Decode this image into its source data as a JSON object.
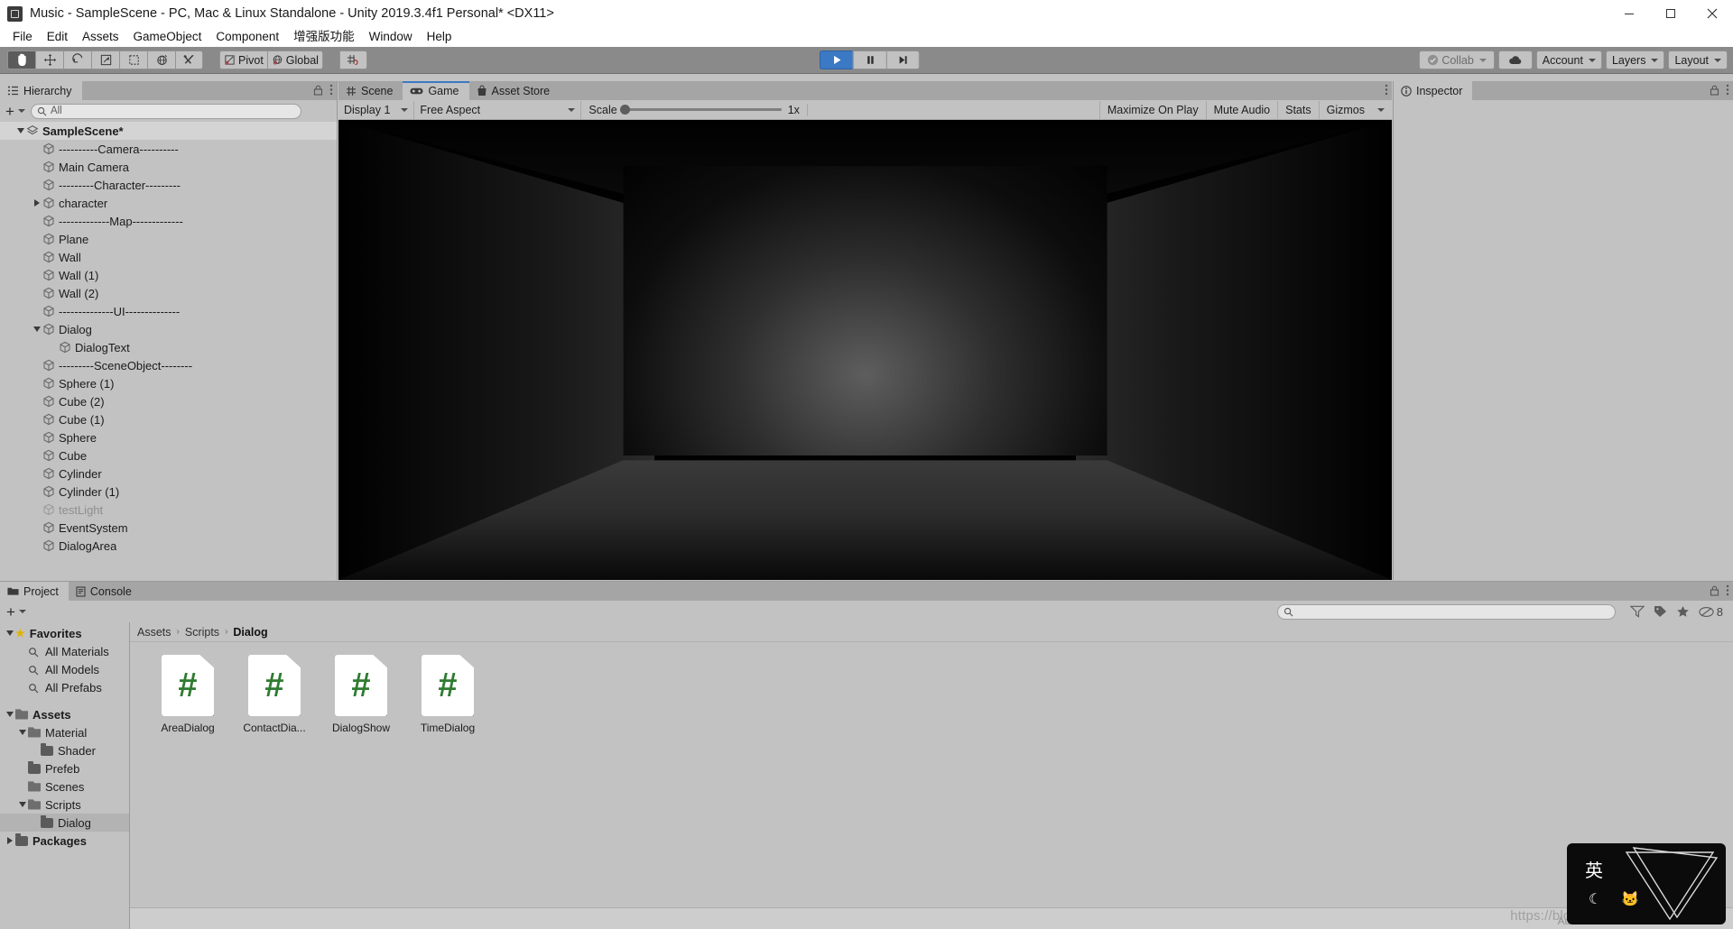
{
  "window": {
    "title": "Music - SampleScene - PC, Mac & Linux Standalone - Unity 2019.3.4f1 Personal* <DX11>",
    "app_icon": "unity-icon",
    "minimize": "minimize-icon",
    "maximize": "maximize-icon",
    "close": "close-icon"
  },
  "menu": {
    "items": [
      "File",
      "Edit",
      "Assets",
      "GameObject",
      "Component",
      "增强版功能",
      "Window",
      "Help"
    ]
  },
  "toolbar": {
    "tools": [
      {
        "name": "hand-tool",
        "selected": true
      },
      {
        "name": "move-tool",
        "selected": false
      },
      {
        "name": "rotate-tool",
        "selected": false
      },
      {
        "name": "scale-tool",
        "selected": false
      },
      {
        "name": "rect-tool",
        "selected": false
      },
      {
        "name": "transform-tool",
        "selected": false
      },
      {
        "name": "custom-tool",
        "selected": false
      }
    ],
    "pivot_label": "Pivot",
    "global_label": "Global",
    "grid_label": "grid-snap",
    "play_label": "play",
    "pause_label": "pause",
    "step_label": "step",
    "play_active": true,
    "collab_label": "Collab",
    "cloud_label": "cloud-icon",
    "account_label": "Account",
    "layers_label": "Layers",
    "layout_label": "Layout",
    "accent_blue": "#3b79c4"
  },
  "hierarchy": {
    "tab_label": "Hierarchy",
    "search_placeholder": "All",
    "add_label": "+",
    "items": [
      {
        "label": "SampleScene*",
        "indent": 0,
        "arrow": "down",
        "icon": "scene-icon",
        "selected": true,
        "bold": true,
        "disabled": false
      },
      {
        "label": "----------Camera----------",
        "indent": 1,
        "arrow": "none",
        "icon": "gameobject-icon",
        "selected": false,
        "bold": false,
        "disabled": false
      },
      {
        "label": "Main Camera",
        "indent": 1,
        "arrow": "none",
        "icon": "gameobject-icon",
        "selected": false,
        "bold": false,
        "disabled": false
      },
      {
        "label": "---------Character---------",
        "indent": 1,
        "arrow": "none",
        "icon": "gameobject-icon",
        "selected": false,
        "bold": false,
        "disabled": false
      },
      {
        "label": "character",
        "indent": 1,
        "arrow": "right",
        "icon": "gameobject-icon",
        "selected": false,
        "bold": false,
        "disabled": false
      },
      {
        "label": "-------------Map-------------",
        "indent": 1,
        "arrow": "none",
        "icon": "gameobject-icon",
        "selected": false,
        "bold": false,
        "disabled": false
      },
      {
        "label": "Plane",
        "indent": 1,
        "arrow": "none",
        "icon": "gameobject-icon",
        "selected": false,
        "bold": false,
        "disabled": false
      },
      {
        "label": "Wall",
        "indent": 1,
        "arrow": "none",
        "icon": "gameobject-icon",
        "selected": false,
        "bold": false,
        "disabled": false
      },
      {
        "label": "Wall (1)",
        "indent": 1,
        "arrow": "none",
        "icon": "gameobject-icon",
        "selected": false,
        "bold": false,
        "disabled": false
      },
      {
        "label": "Wall (2)",
        "indent": 1,
        "arrow": "none",
        "icon": "gameobject-icon",
        "selected": false,
        "bold": false,
        "disabled": false
      },
      {
        "label": "--------------UI--------------",
        "indent": 1,
        "arrow": "none",
        "icon": "gameobject-icon",
        "selected": false,
        "bold": false,
        "disabled": false
      },
      {
        "label": "Dialog",
        "indent": 1,
        "arrow": "down",
        "icon": "gameobject-icon",
        "selected": false,
        "bold": false,
        "disabled": false
      },
      {
        "label": "DialogText",
        "indent": 2,
        "arrow": "none",
        "icon": "gameobject-icon",
        "selected": false,
        "bold": false,
        "disabled": false
      },
      {
        "label": "---------SceneObject--------",
        "indent": 1,
        "arrow": "none",
        "icon": "gameobject-icon",
        "selected": false,
        "bold": false,
        "disabled": false
      },
      {
        "label": "Sphere (1)",
        "indent": 1,
        "arrow": "none",
        "icon": "gameobject-icon",
        "selected": false,
        "bold": false,
        "disabled": false
      },
      {
        "label": "Cube (2)",
        "indent": 1,
        "arrow": "none",
        "icon": "gameobject-icon",
        "selected": false,
        "bold": false,
        "disabled": false
      },
      {
        "label": "Cube (1)",
        "indent": 1,
        "arrow": "none",
        "icon": "gameobject-icon",
        "selected": false,
        "bold": false,
        "disabled": false
      },
      {
        "label": "Sphere",
        "indent": 1,
        "arrow": "none",
        "icon": "gameobject-icon",
        "selected": false,
        "bold": false,
        "disabled": false
      },
      {
        "label": "Cube",
        "indent": 1,
        "arrow": "none",
        "icon": "gameobject-icon",
        "selected": false,
        "bold": false,
        "disabled": false
      },
      {
        "label": "Cylinder",
        "indent": 1,
        "arrow": "none",
        "icon": "gameobject-icon",
        "selected": false,
        "bold": false,
        "disabled": false
      },
      {
        "label": "Cylinder (1)",
        "indent": 1,
        "arrow": "none",
        "icon": "gameobject-icon",
        "selected": false,
        "bold": false,
        "disabled": false
      },
      {
        "label": "testLight",
        "indent": 1,
        "arrow": "none",
        "icon": "gameobject-icon",
        "selected": false,
        "bold": false,
        "disabled": true
      },
      {
        "label": "EventSystem",
        "indent": 1,
        "arrow": "none",
        "icon": "gameobject-icon",
        "selected": false,
        "bold": false,
        "disabled": false
      },
      {
        "label": "DialogArea",
        "indent": 1,
        "arrow": "none",
        "icon": "gameobject-icon",
        "selected": false,
        "bold": false,
        "disabled": false
      }
    ]
  },
  "center": {
    "tabs": [
      {
        "label": "Scene",
        "icon": "scene-hash-icon",
        "active": false
      },
      {
        "label": "Game",
        "icon": "gamepad-icon",
        "active": true
      },
      {
        "label": "Asset Store",
        "icon": "store-bag-icon",
        "active": false
      }
    ],
    "game_toolbar": {
      "display": "Display 1",
      "aspect": "Free Aspect",
      "scale_label": "Scale",
      "scale_value": "1x",
      "maximize_on_play": "Maximize On Play",
      "mute_audio": "Mute Audio",
      "stats": "Stats",
      "gizmos": "Gizmos"
    }
  },
  "inspector": {
    "tab_label": "Inspector",
    "icon": "info-icon"
  },
  "project": {
    "tabs": [
      {
        "label": "Project",
        "icon": "folder-icon",
        "active": true
      },
      {
        "label": "Console",
        "icon": "console-icon",
        "active": false
      }
    ],
    "add_label": "+",
    "search_placeholder": "",
    "badge_count": "8",
    "tree": [
      {
        "label": "Favorites",
        "indent": 0,
        "arrow": "down",
        "icon": "star-icon",
        "bold": true,
        "selected": false
      },
      {
        "label": "All Materials",
        "indent": 1,
        "arrow": "none",
        "icon": "search-icon",
        "bold": false,
        "selected": false
      },
      {
        "label": "All Models",
        "indent": 1,
        "arrow": "none",
        "icon": "search-icon",
        "bold": false,
        "selected": false
      },
      {
        "label": "All Prefabs",
        "indent": 1,
        "arrow": "none",
        "icon": "search-icon",
        "bold": false,
        "selected": false
      },
      {
        "label": "",
        "indent": 0,
        "arrow": "none",
        "icon": "spacer",
        "bold": false,
        "selected": false
      },
      {
        "label": "Assets",
        "indent": 0,
        "arrow": "down",
        "icon": "folder-open-icon",
        "bold": true,
        "selected": false
      },
      {
        "label": "Material",
        "indent": 1,
        "arrow": "down",
        "icon": "folder-open-icon",
        "bold": false,
        "selected": false
      },
      {
        "label": "Shader",
        "indent": 2,
        "arrow": "none",
        "icon": "folder-icon",
        "bold": false,
        "selected": false
      },
      {
        "label": "Prefeb",
        "indent": 1,
        "arrow": "none",
        "icon": "folder-icon",
        "bold": false,
        "selected": false
      },
      {
        "label": "Scenes",
        "indent": 1,
        "arrow": "none",
        "icon": "folder-open-icon",
        "bold": false,
        "selected": false
      },
      {
        "label": "Scripts",
        "indent": 1,
        "arrow": "down",
        "icon": "folder-open-icon",
        "bold": false,
        "selected": false
      },
      {
        "label": "Dialog",
        "indent": 2,
        "arrow": "none",
        "icon": "folder-icon",
        "bold": false,
        "selected": true
      },
      {
        "label": "Packages",
        "indent": 0,
        "arrow": "right",
        "icon": "folder-icon",
        "bold": true,
        "selected": false
      }
    ],
    "breadcrumb": [
      "Assets",
      "Scripts",
      "Dialog"
    ],
    "assets": [
      {
        "label": "AreaDialog",
        "icon": "csharp-script-icon"
      },
      {
        "label": "ContactDia...",
        "icon": "csharp-script-icon"
      },
      {
        "label": "DialogShow",
        "icon": "csharp-script-icon"
      },
      {
        "label": "TimeDialog",
        "icon": "csharp-script-icon"
      }
    ],
    "footer_auto": "Auto Ge"
  },
  "overlays": {
    "ime_text": "英",
    "ime_moon": "☾",
    "ime_cat": "🐱",
    "ime_logo": "sogou-triangle-logo",
    "watermark": "https://blog.csdn.net/qq_37765462"
  }
}
